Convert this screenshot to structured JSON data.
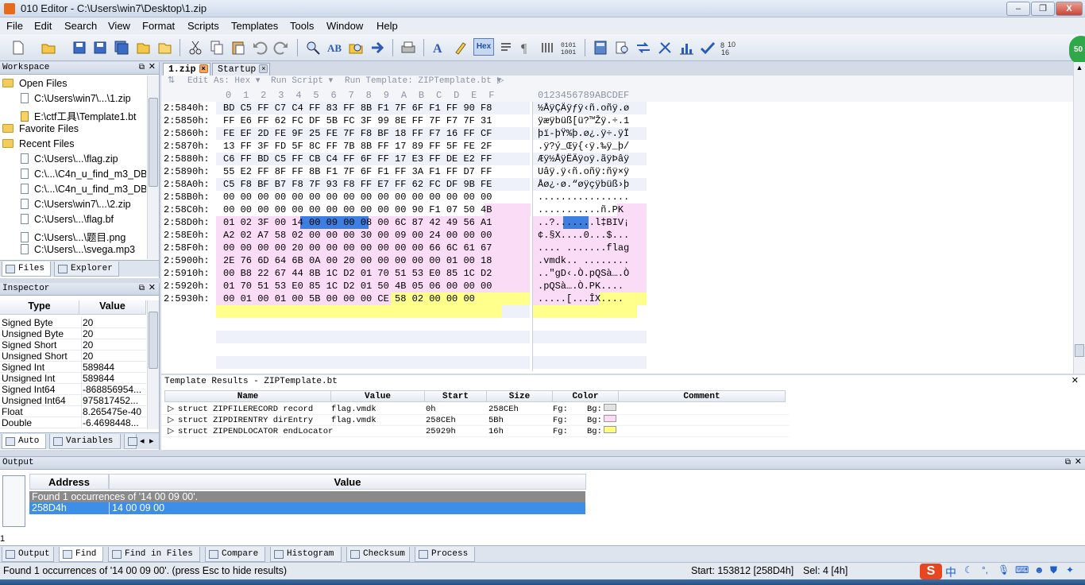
{
  "window": {
    "title": "010 Editor - C:\\Users\\win7\\Desktop\\1.zip",
    "minimize": "–",
    "maximize": "❐",
    "close": "X"
  },
  "menu": [
    "File",
    "Edit",
    "Search",
    "View",
    "Format",
    "Scripts",
    "Templates",
    "Tools",
    "Window",
    "Help"
  ],
  "toolbar": {
    "hex_label": "Hex",
    "badge": "50"
  },
  "workspace": {
    "title": "Workspace",
    "open_files_label": "Open Files",
    "open_files": [
      "C:\\Users\\win7\\...\\1.zip",
      "E:\\ctf工具\\Template1.bt"
    ],
    "favorite_files_label": "Favorite Files",
    "recent_files_label": "Recent Files",
    "recent_files": [
      "C:\\Users\\...\\flag.zip",
      "C:\\...\\C4n_u_find_m3_DB",
      "C:\\...\\C4n_u_find_m3_DB",
      "C:\\Users\\win7\\...\\2.zip",
      "C:\\Users\\...\\flag.bf",
      "C:\\Users\\...\\题目.png",
      "C:\\Users\\...\\svega.mp3"
    ],
    "tabs": [
      "Files",
      "Explorer"
    ]
  },
  "inspector": {
    "title": "Inspector",
    "col_type": "Type",
    "col_value": "Value",
    "rows": [
      {
        "type": "Signed Byte",
        "value": "20"
      },
      {
        "type": "Unsigned Byte",
        "value": "20"
      },
      {
        "type": "Signed Short",
        "value": "20"
      },
      {
        "type": "Unsigned Short",
        "value": "20"
      },
      {
        "type": "Signed Int",
        "value": "589844"
      },
      {
        "type": "Unsigned Int",
        "value": "589844"
      },
      {
        "type": "Signed Int64",
        "value": "-868856954..."
      },
      {
        "type": "Unsigned Int64",
        "value": "975817452..."
      },
      {
        "type": "Float",
        "value": "8.265475e-40"
      },
      {
        "type": "Double",
        "value": "-6.4698448..."
      }
    ],
    "tabs": [
      "Auto",
      "Variables"
    ]
  },
  "editor": {
    "tabs": [
      "1.zip",
      "Startup"
    ],
    "edit_as": "Edit As: Hex",
    "run_script": "Run Script",
    "run_template": "Run Template: ZIPTemplate.bt",
    "col_header_hex": "0  1  2  3  4  5  6  7  8  9  A  B  C  D  E  F",
    "col_header_ascii": "0123456789ABCDEF",
    "rows": [
      {
        "addr": "2:5840h:",
        "hex": "BD C5 FF C7 C4 FF 83 FF 8B F1 7F 6F F1 FF 90 F8",
        "ascii": "½ÅÿÇÄÿƒÿ‹ñ.oñÿ.ø"
      },
      {
        "addr": "2:5850h:",
        "hex": "FF E6 FF 62 FC DF 5B FC 3F 99 8E FF 7F F7 7F 31",
        "ascii": "ÿæÿbüß[ü?™Žÿ.÷.1"
      },
      {
        "addr": "2:5860h:",
        "hex": "FE EF 2D FE 9F 25 FE 7F F8 BF 18 FF F7 16 FF CF",
        "ascii": "þï-þŸ%þ.ø¿.ÿ÷.ÿÏ"
      },
      {
        "addr": "2:5870h:",
        "hex": "13 FF 3F FD 5F 8C FF 7B 8B FF 17 89 FF 5F FE 2F",
        "ascii": ".ÿ?ý_Œÿ{‹ÿ.‰ÿ_þ/"
      },
      {
        "addr": "2:5880h:",
        "hex": "C6 FF BD C5 FF CB C4 FF 6F FF 17 E3 FF DE E2 FF",
        "ascii": "Æÿ½ÅÿËÄÿoÿ.ãÿÞâÿ"
      },
      {
        "addr": "2:5890h:",
        "hex": "55 E2 FF 8F FF 8B F1 7F 6F F1 FF 3A F1 FF D7 FF",
        "ascii": "Uâÿ.ÿ‹ñ.oñÿ:ñÿ×ÿ"
      },
      {
        "addr": "2:58A0h:",
        "hex": "C5 F8 BF B7 F8 7F 93 F8 FF E7 FF 62 FC DF 9B FE",
        "ascii": "Åø¿·ø.“øÿçÿbüß›þ"
      },
      {
        "addr": "2:58B0h:",
        "hex": "00 00 00 00 00 00 00 00 00 00 00 00 00 00 00 00",
        "ascii": "................"
      },
      {
        "addr": "2:58C0h:",
        "hex": "00 00 00 00 00 00 00 00 00 00 00 90 F1 07 50 4B",
        "ascii": "...........ñ.PK"
      },
      {
        "addr": "2:58D0h:",
        "hex": "01 02 3F 00 14 00 09 00 08 00 6C 87 42 49 56 A1",
        "ascii": "..?.......l‡BIV¡"
      },
      {
        "addr": "2:58E0h:",
        "hex": "A2 02 A7 58 02 00 00 00 30 00 09 00 24 00 00 00",
        "ascii": "¢.§X....0...$..."
      },
      {
        "addr": "2:58F0h:",
        "hex": "00 00 00 00 20 00 00 00 00 00 00 00 66 6C 61 67",
        "ascii": ".... .......flag"
      },
      {
        "addr": "2:5900h:",
        "hex": "2E 76 6D 64 6B 0A 00 20 00 00 00 00 00 01 00 18",
        "ascii": ".vmdk.. ........"
      },
      {
        "addr": "2:5910h:",
        "hex": "00 B8 22 67 44 8B 1C D2 01 70 51 53 E0 85 1C D2",
        "ascii": "..\"gD‹.Ò.pQSà….Ò"
      },
      {
        "addr": "2:5920h:",
        "hex": "01 70 51 53 E0 85 1C D2 01 50 4B 05 06 00 00 00",
        "ascii": ".pQSà….Ò.PK...."
      },
      {
        "addr": "2:5930h:",
        "hex": "00 01 00 01 00 5B 00 00 00 CE 58 02 00 00 00",
        "ascii": ".....[...ÎX...."
      }
    ]
  },
  "template": {
    "title": "Template Results - ZIPTemplate.bt",
    "columns": [
      "Name",
      "Value",
      "Start",
      "Size",
      "Color",
      "Comment"
    ],
    "rows": [
      {
        "name": "struct ZIPFILERECORD record",
        "value": "flag.vmdk",
        "start": "0h",
        "size": "258CEh",
        "fg": "Fg:",
        "bg": "Bg:"
      },
      {
        "name": "struct ZIPDIRENTRY dirEntry",
        "value": "flag.vmdk",
        "start": "258CEh",
        "size": "5Bh",
        "fg": "Fg:",
        "bg": "Bg:"
      },
      {
        "name": "struct ZIPENDLOCATOR endLocator",
        "value": "",
        "start": "25929h",
        "size": "16h",
        "fg": "Fg:",
        "bg": "Bg:"
      }
    ],
    "bg_colors": [
      "#e3e3e3",
      "#fcdcf5",
      "#ffff80"
    ]
  },
  "output": {
    "title": "Output",
    "col_address": "Address",
    "col_value": "Value",
    "found_text": "Found 1 occurrences of '14 00 09 00'.",
    "result_address": "258D4h",
    "result_value": "14 00 09 00",
    "side_number": "1",
    "tabs": [
      "Output",
      "Find",
      "Find in Files",
      "Compare",
      "Histogram",
      "Checksum",
      "Process"
    ]
  },
  "status": {
    "message": "Found 1 occurrences of '14 00 09 00'. (press Esc to hide results)",
    "start": "Start: 153812 [258D4h]",
    "sel": "Sel: 4 [4h]",
    "ime": "中"
  }
}
